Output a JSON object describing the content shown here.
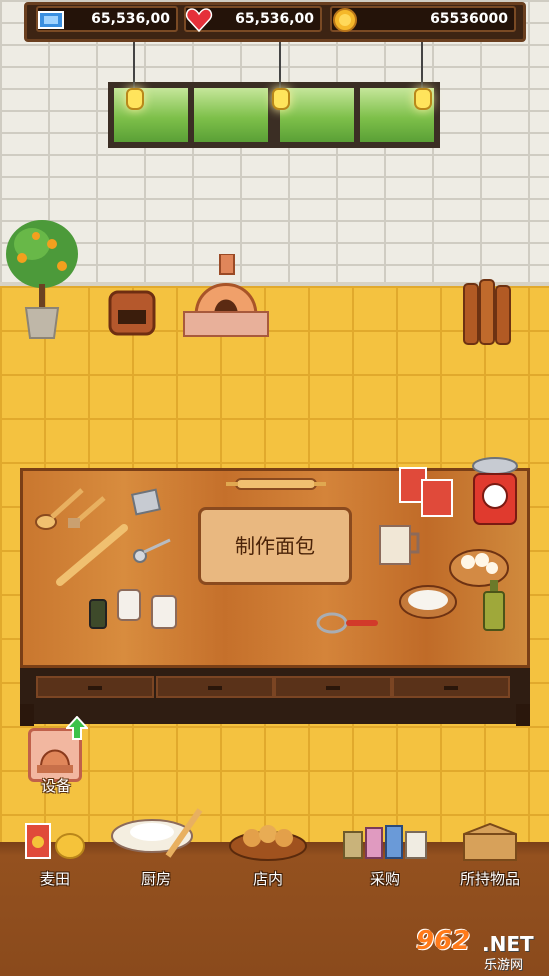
{
  "status": {
    "tickets": "65,536,00",
    "hearts": "65,536,00",
    "coins": "65536000"
  },
  "counter": {
    "make_bread_label": "制作面包"
  },
  "equipment": {
    "label": "设备"
  },
  "nav": [
    {
      "label": "麦田",
      "icon": "wheat-field-icon"
    },
    {
      "label": "厨房",
      "icon": "kitchen-icon"
    },
    {
      "label": "店内",
      "icon": "store-icon"
    },
    {
      "label": "采购",
      "icon": "purchase-icon"
    },
    {
      "label": "所持物品",
      "icon": "inventory-icon"
    }
  ],
  "watermark": {
    "brand": "962",
    "net": ".NET",
    "sub": "乐游网"
  },
  "colors": {
    "floor": "#f4c240",
    "wall": "#eeece4",
    "wood": "#c9772f",
    "nav_bg": "#8a4a1c"
  }
}
